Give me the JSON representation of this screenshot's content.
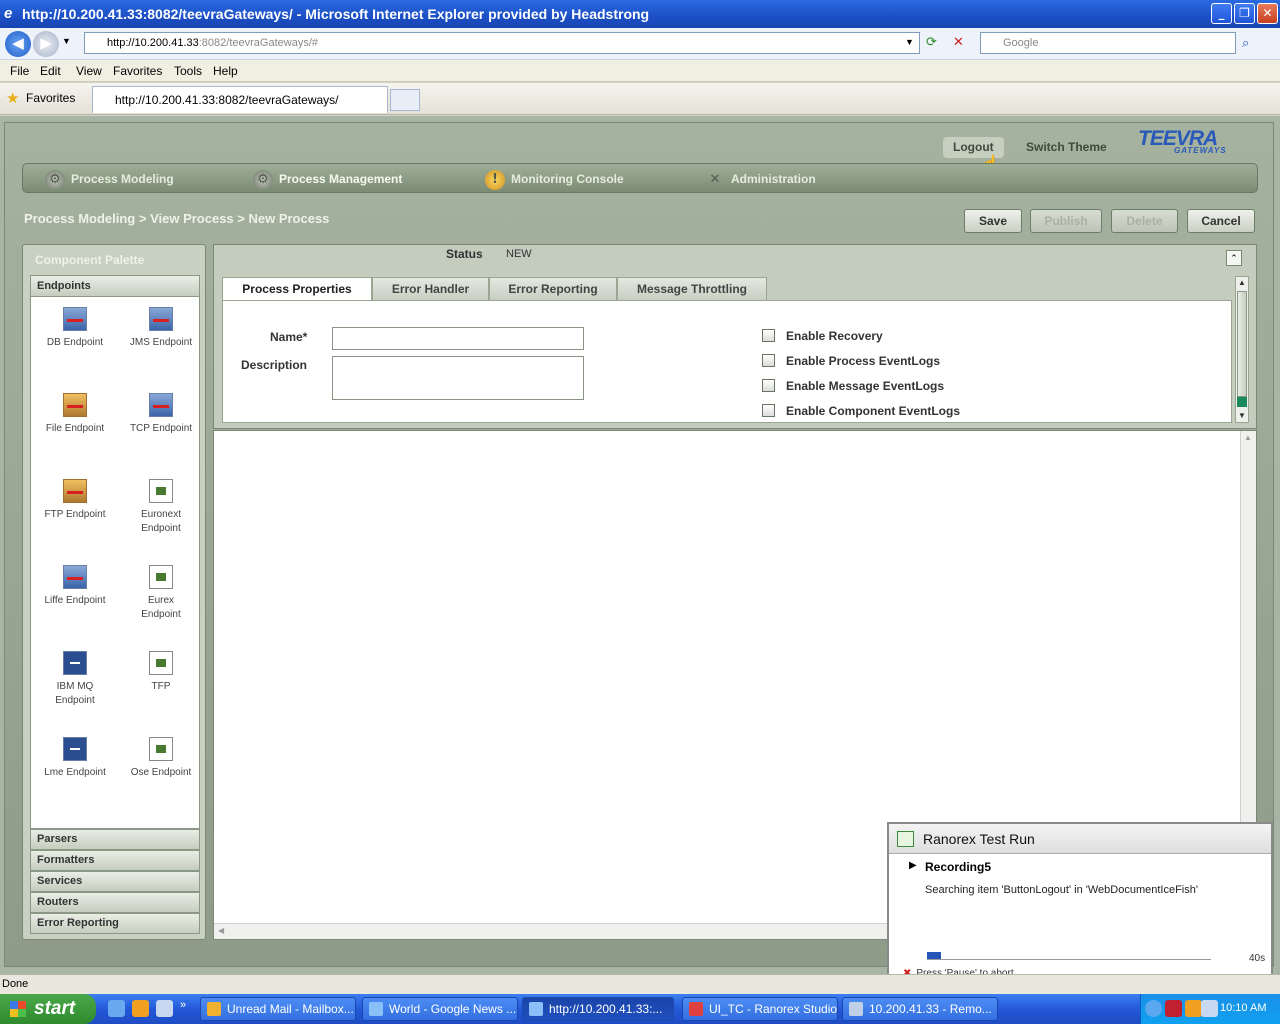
{
  "browser": {
    "title": "http://10.200.41.33:8082/teevraGateways/ - Microsoft Internet Explorer provided by Headstrong",
    "url_host": "http://10.200.41.33",
    "url_rest": ":8082/teevraGateways/#",
    "search_placeholder": "Google",
    "menu": [
      "File",
      "Edit",
      "View",
      "Favorites",
      "Tools",
      "Help"
    ],
    "favorites_label": "Favorites",
    "tab_label": "http://10.200.41.33:8082/teevraGateways/",
    "status": "Done"
  },
  "app": {
    "header": {
      "logout": "Logout",
      "switch_theme": "Switch Theme",
      "logo": "TEEVRA",
      "logo_sub": "GATEWAYS"
    },
    "nav": [
      "Process Modeling",
      "Process Management",
      "Monitoring Console",
      "Administration"
    ],
    "breadcrumb": "Process Modeling > View Process > New Process",
    "actions": {
      "save": "Save",
      "publish": "Publish",
      "delete": "Delete",
      "cancel": "Cancel"
    },
    "palette": {
      "title": "Component Palette",
      "endpoints_header": "Endpoints",
      "endpoints": [
        "DB Endpoint",
        "JMS Endpoint",
        "File Endpoint",
        "TCP Endpoint",
        "FTP Endpoint",
        "Euronext Endpoint",
        "Liffe Endpoint",
        "Eurex Endpoint",
        "IBM MQ Endpoint",
        "TFP",
        "Lme Endpoint",
        "Ose Endpoint"
      ],
      "categories": [
        "Parsers",
        "Formatters",
        "Services",
        "Routers",
        "Error Reporting"
      ]
    },
    "process": {
      "status_label": "Status",
      "status_value": "NEW",
      "tabs": [
        "Process Properties",
        "Error Handler",
        "Error Reporting",
        "Message Throttling"
      ],
      "name_label": "Name*",
      "description_label": "Description",
      "checkboxes": [
        "Enable Recovery",
        "Enable Process EventLogs",
        "Enable Message EventLogs",
        "Enable Component EventLogs"
      ]
    }
  },
  "ranorex": {
    "title": "Ranorex Test Run",
    "recording": "Recording5",
    "message": "Searching item 'ButtonLogout' in 'WebDocumentIceFish'",
    "progress": 0.05,
    "seconds": "40s",
    "abort": "Press 'Pause' to abort."
  },
  "taskbar": {
    "start": "start",
    "tasks": [
      "Unread Mail - Mailbox...",
      "World - Google News ...",
      "http://10.200.41.33:...",
      "UI_TC - Ranorex Studio",
      "10.200.41.33 - Remo..."
    ],
    "clock": "10:10 AM"
  }
}
